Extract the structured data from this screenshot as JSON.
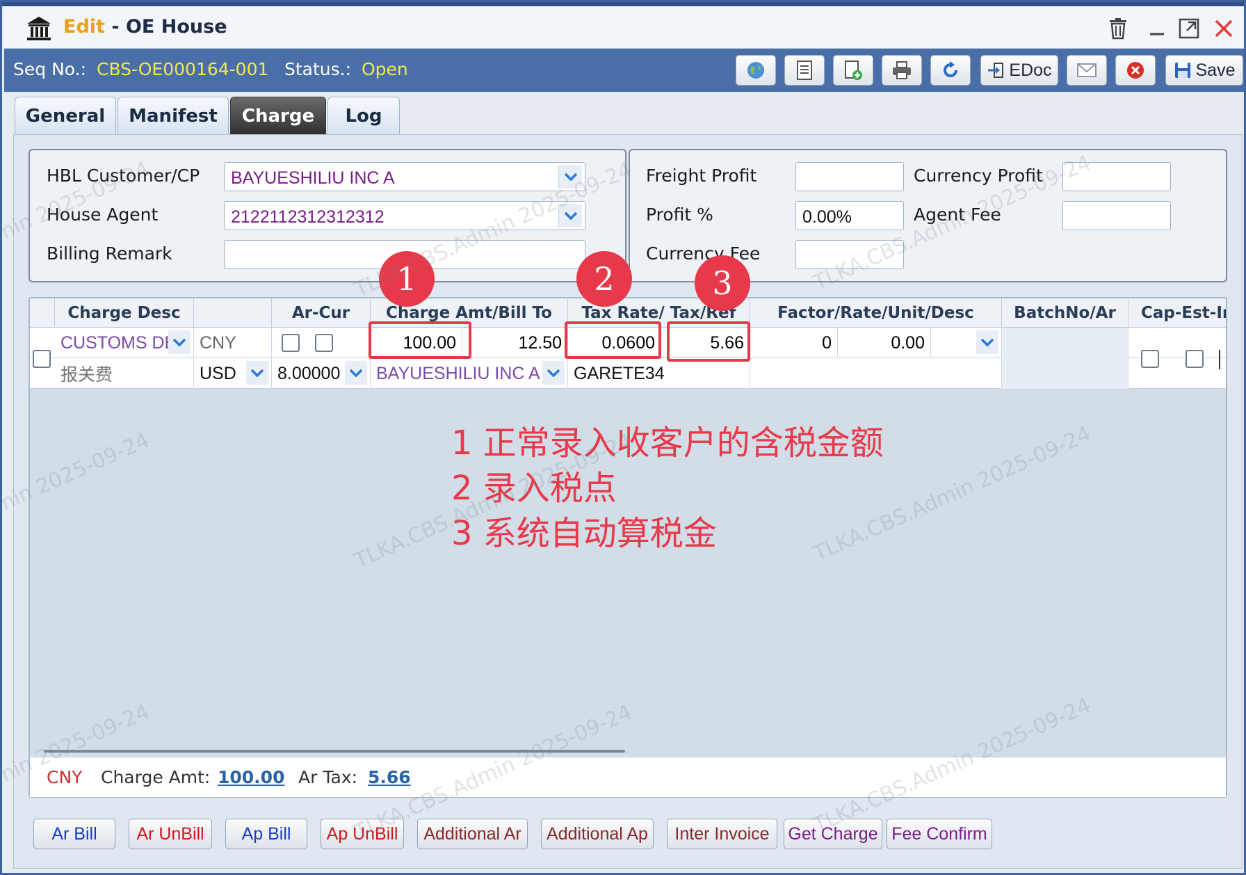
{
  "window": {
    "edit_word": "Edit",
    "separator": " - ",
    "title": "OE House"
  },
  "seqbar": {
    "seq_label": "Seq No.:",
    "seq_value": "CBS-OE000164-001",
    "status_label": "Status.:",
    "status_value": "Open",
    "edoc_label": "EDoc",
    "save_label": "Save"
  },
  "tabs": [
    "General",
    "Manifest",
    "Charge",
    "Log"
  ],
  "left_form": {
    "hbl_label": "HBL Customer/CP",
    "hbl_value": "BAYUESHILIU INC A",
    "agent_label": "House Agent",
    "agent_value": "2122112312312312",
    "remark_label": "Billing Remark",
    "remark_value": ""
  },
  "right_form": {
    "freight_profit_label": "Freight Profit",
    "freight_profit_value": "",
    "currency_profit_label": "Currency Profit",
    "currency_profit_value": "",
    "profit_pct_label": "Profit %",
    "profit_pct_value": "0.00%",
    "agent_fee_label": "Agent Fee",
    "agent_fee_value": "",
    "currency_fee_label": "Currency Fee",
    "currency_fee_value": ""
  },
  "grid": {
    "headers": [
      "Charge Desc",
      "Ar-Cur",
      "Charge Amt/Bill To",
      "Tax Rate/ Tax/Ref",
      "Factor/Rate/Unit/Desc",
      "BatchNo/Ar",
      "Cap-Est-Int"
    ],
    "row1": {
      "charge_desc": "CUSTOMS DEC",
      "currency": "CNY",
      "charge_amt": "100.00",
      "amt2": "12.50",
      "tax_rate": "0.0600",
      "tax": "5.66",
      "factor": "0",
      "rate": "0.00"
    },
    "row2": {
      "desc_cn": "报关费",
      "currency": "USD",
      "ex_rate": "8.00000",
      "bill_to": "BAYUESHILIU INC A",
      "ref": "GARETE34"
    }
  },
  "annotations": {
    "c1": "1",
    "c2": "2",
    "c3": "3",
    "note1": "1 正常录入收客户的含税金额",
    "note2": "2 录入税点",
    "note3": "3 系统自动算税金"
  },
  "totals": {
    "currency": "CNY",
    "charge_amt_label": "Charge Amt:",
    "charge_amt_value": "100.00",
    "ar_tax_label": "Ar Tax:",
    "ar_tax_value": "5.66"
  },
  "bottom_buttons": [
    {
      "label": "Ar Bill",
      "color": "#1a3bc8"
    },
    {
      "label": "Ar UnBill",
      "color": "#d01818"
    },
    {
      "label": "Ap Bill",
      "color": "#1a3bc8"
    },
    {
      "label": "Ap UnBill",
      "color": "#d01818"
    },
    {
      "label": "Additional Ar",
      "color": "#8a2a2a"
    },
    {
      "label": "Additional Ap",
      "color": "#8a2a2a"
    },
    {
      "label": "Inter Invoice",
      "color": "#8a2a2a"
    },
    {
      "label": "Get Charge",
      "color": "#7a1c8a"
    },
    {
      "label": "Fee Confirm",
      "color": "#7a1c8a"
    }
  ],
  "colors": {
    "header_bar": "#4a6ea8",
    "accent_yellow": "#f5e94a",
    "annotation_red": "#e8394a"
  }
}
